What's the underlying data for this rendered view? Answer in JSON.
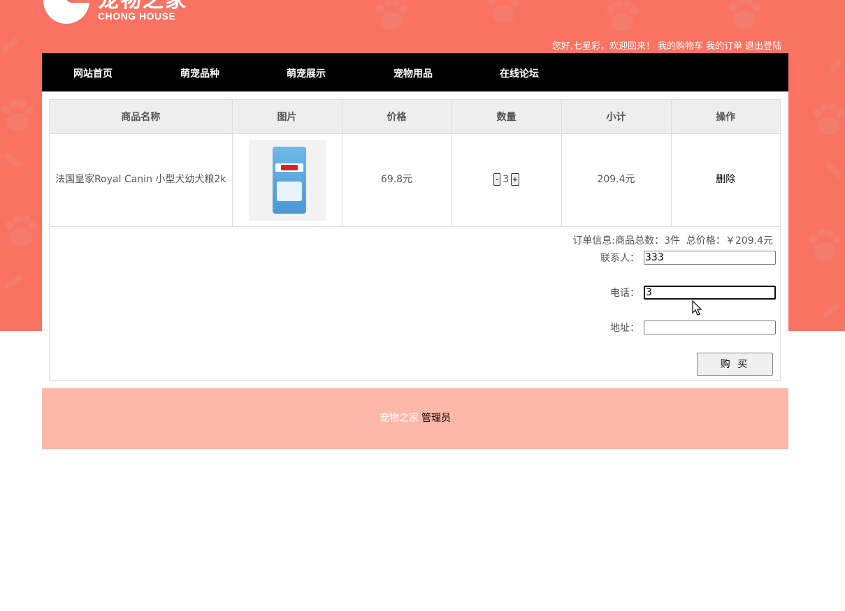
{
  "brand": {
    "name_cn": "宠物之家",
    "name_en": "CHONG HOUSE",
    "color": "#f97262"
  },
  "userbar": {
    "greeting": "您好,七星彩，欢迎回来！",
    "cart": "我的购物车",
    "orders": "我的订单",
    "logout": "退出登陆"
  },
  "nav": {
    "items": [
      {
        "label": "网站首页"
      },
      {
        "label": "萌宠品种"
      },
      {
        "label": "萌宠展示"
      },
      {
        "label": "宠物用品"
      },
      {
        "label": "在线论坛"
      }
    ]
  },
  "cart": {
    "headers": [
      "商品名称",
      "图片",
      "价格",
      "数量",
      "小计",
      "操作"
    ],
    "rows": [
      {
        "name": "法国皇家Royal Canin 小型犬幼犬粮2k",
        "price": "69.8元",
        "qty_minus": "-",
        "qty": "3",
        "qty_plus": "+",
        "subtotal": "209.4元",
        "action": "删除"
      }
    ]
  },
  "order": {
    "summary": "订单信息:商品总数：3件  总价格：￥209.4元",
    "contact_label": "联系人：",
    "contact_value": "333",
    "phone_label": "电话：",
    "phone_value": "3",
    "address_label": "地址：",
    "address_value": "",
    "buy_label": "购 买"
  },
  "footer": {
    "brand": "宠物之家",
    "admin": "管理员"
  },
  "icons": {
    "paw": "paw-icon",
    "cursor": "mouse-cursor-icon"
  }
}
